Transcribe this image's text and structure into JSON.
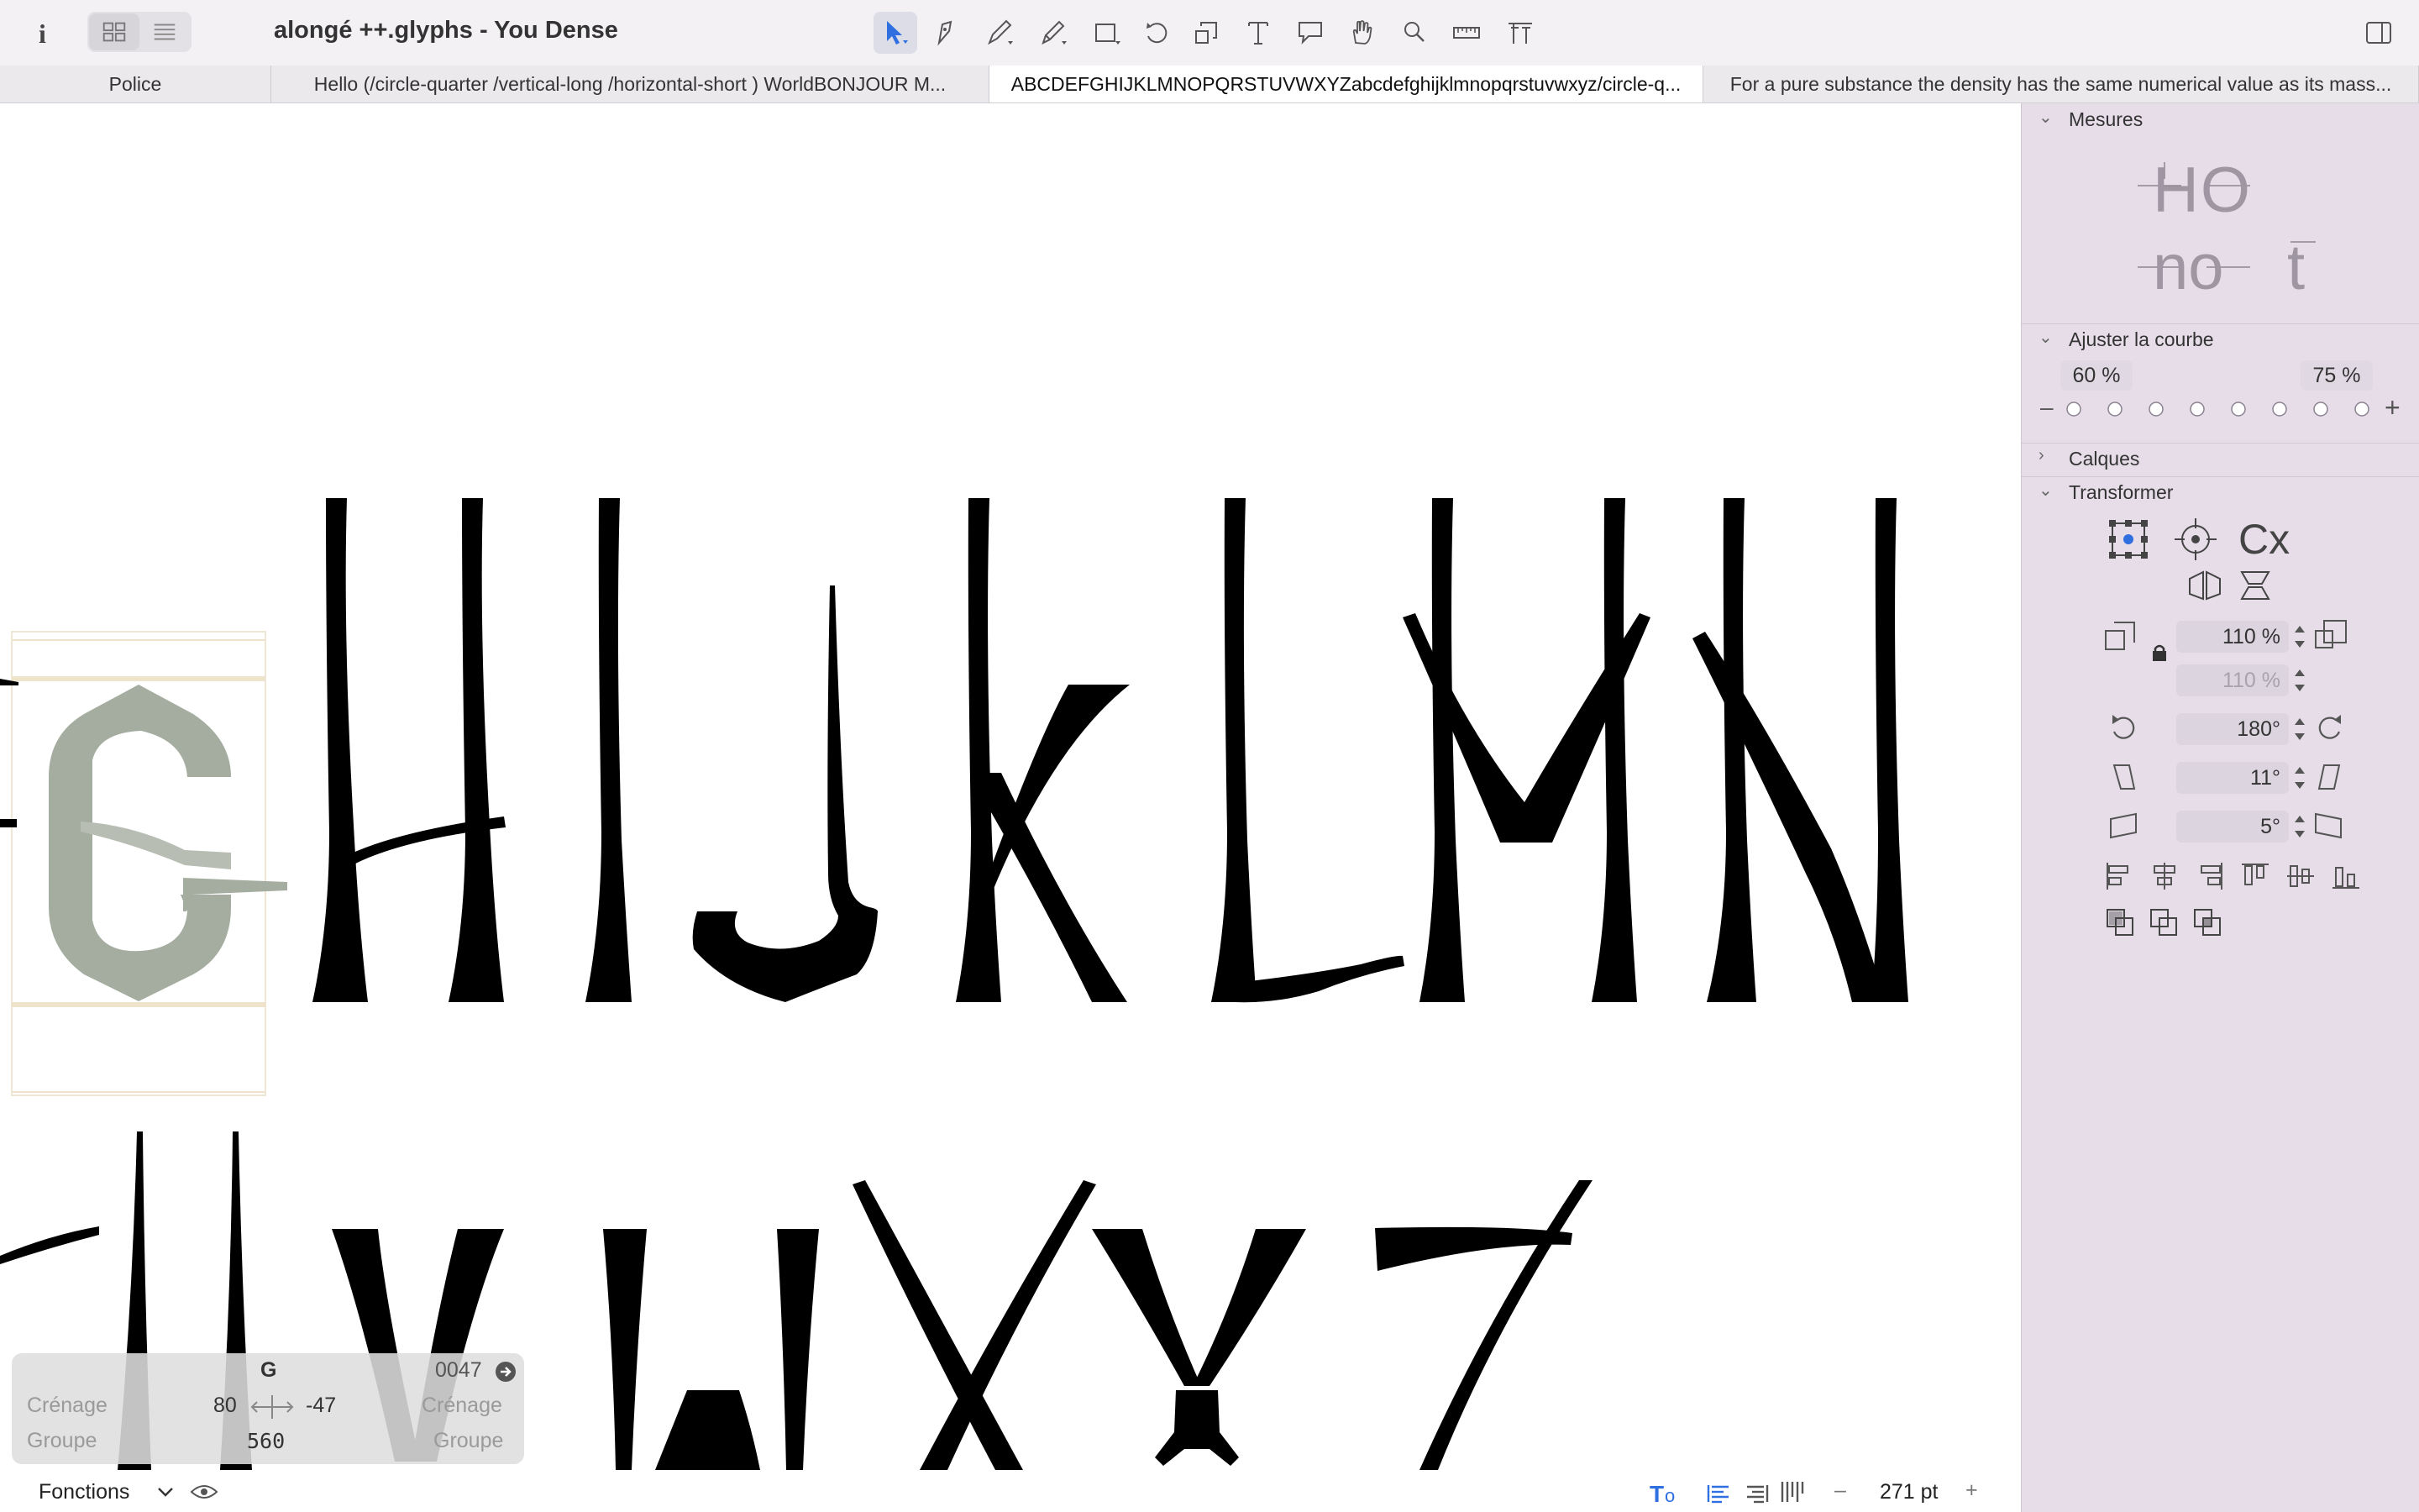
{
  "window": {
    "title": "alongé ++.glyphs - You Dense"
  },
  "toolbar": {
    "tools": [
      "select-icon",
      "pen-tool-icon",
      "draw-icon",
      "pencil-icon",
      "rectangle-icon",
      "rotate-icon",
      "scale-icon",
      "text-tool-icon",
      "annotation-icon",
      "hand-icon",
      "zoom-icon",
      "measure-icon",
      "type-metrics-icon"
    ]
  },
  "tabs": [
    {
      "label": "Police",
      "active": false
    },
    {
      "label": "Hello (/circle-quarter  /vertical-long  /horizontal-short ) WorldBONJOUR M...",
      "active": false
    },
    {
      "label": "ABCDEFGHIJKLMNOPQRSTUVWXYZabcdefghijklmnopqrstuvwxyz/circle-q...",
      "active": true
    },
    {
      "label": "For a pure substance the density has the same numerical value as its mass...",
      "active": false
    }
  ],
  "glyph_info": {
    "name": "G",
    "unicode": "0047",
    "kerning_label_left": "Crénage",
    "kerning_label_right": "Crénage",
    "group_label_left": "Groupe",
    "group_label_right": "Groupe",
    "lsb": "80",
    "rsb": "-47",
    "width": "560"
  },
  "bottom": {
    "functions_label": "Fonctions",
    "font_size": "271 pt",
    "minus": "–",
    "plus": "+"
  },
  "panel": {
    "mesures": {
      "title": "Mesures",
      "line1": "HO",
      "line2": "no",
      "line3": "t"
    },
    "curve": {
      "title": "Ajuster la courbe",
      "left_pct": "60 %",
      "right_pct": "75 %",
      "minus": "–",
      "plus": "+"
    },
    "layers": {
      "title": "Calques"
    },
    "transform": {
      "title": "Transformer",
      "cx_label": "Cx",
      "scale_x": "110 %",
      "scale_y": "110 %",
      "rotate": "180°",
      "slant": "11°",
      "skew": "5°"
    }
  },
  "colors": {
    "panel_bg": "#e7dde9",
    "toolbar_bg": "#f3f1f4",
    "accent": "#2f6fe0",
    "glyph": "#000000",
    "active_glyph": "#a4ad9f"
  }
}
